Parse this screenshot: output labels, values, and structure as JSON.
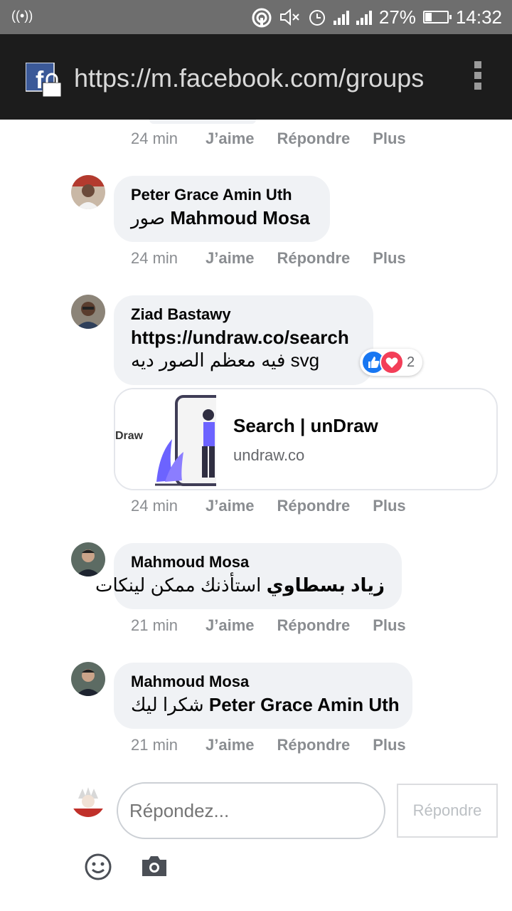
{
  "status_bar": {
    "battery": "27%",
    "battery_level": 0.27,
    "time": "14:32"
  },
  "browser": {
    "url": "https://m.facebook.com/groups"
  },
  "comments": [
    {
      "time": "24 min",
      "like": "J’aime",
      "reply": "Répondre",
      "more": "Plus"
    },
    {
      "author": "Peter Grace Amin Uth",
      "mention": "Mahmoud Mosa",
      "text": "صور",
      "time": "24 min",
      "like": "J’aime",
      "reply": "Répondre",
      "more": "Plus"
    },
    {
      "author": "Ziad Bastawy",
      "line1": "https://undraw.co/search",
      "line2": "فيه معظم الصور ديه svg",
      "reaction_count": "2",
      "link_title": "Search | unDraw",
      "link_domain": "undraw.co",
      "link_thumb_text": "Draw",
      "time": "24 min",
      "like": "J’aime",
      "reply": "Répondre",
      "more": "Plus"
    },
    {
      "author": "Mahmoud Mosa",
      "mention": "زياد بسطاوي",
      "text": "استأذنك ممكن لينكات",
      "time": "21 min",
      "like": "J’aime",
      "reply": "Répondre",
      "more": "Plus"
    },
    {
      "author": "Mahmoud Mosa",
      "mention": "Peter Grace Amin Uth",
      "text": "شكرا ليك",
      "time": "21 min",
      "like": "J’aime",
      "reply": "Répondre",
      "more": "Plus"
    }
  ],
  "composer": {
    "placeholder": "Répondez...",
    "button": "Répondre"
  },
  "colors": {
    "bubble": "#f0f2f5",
    "meta": "#8a8d91",
    "like_blue": "#1877f2",
    "love_red": "#f33e58"
  }
}
